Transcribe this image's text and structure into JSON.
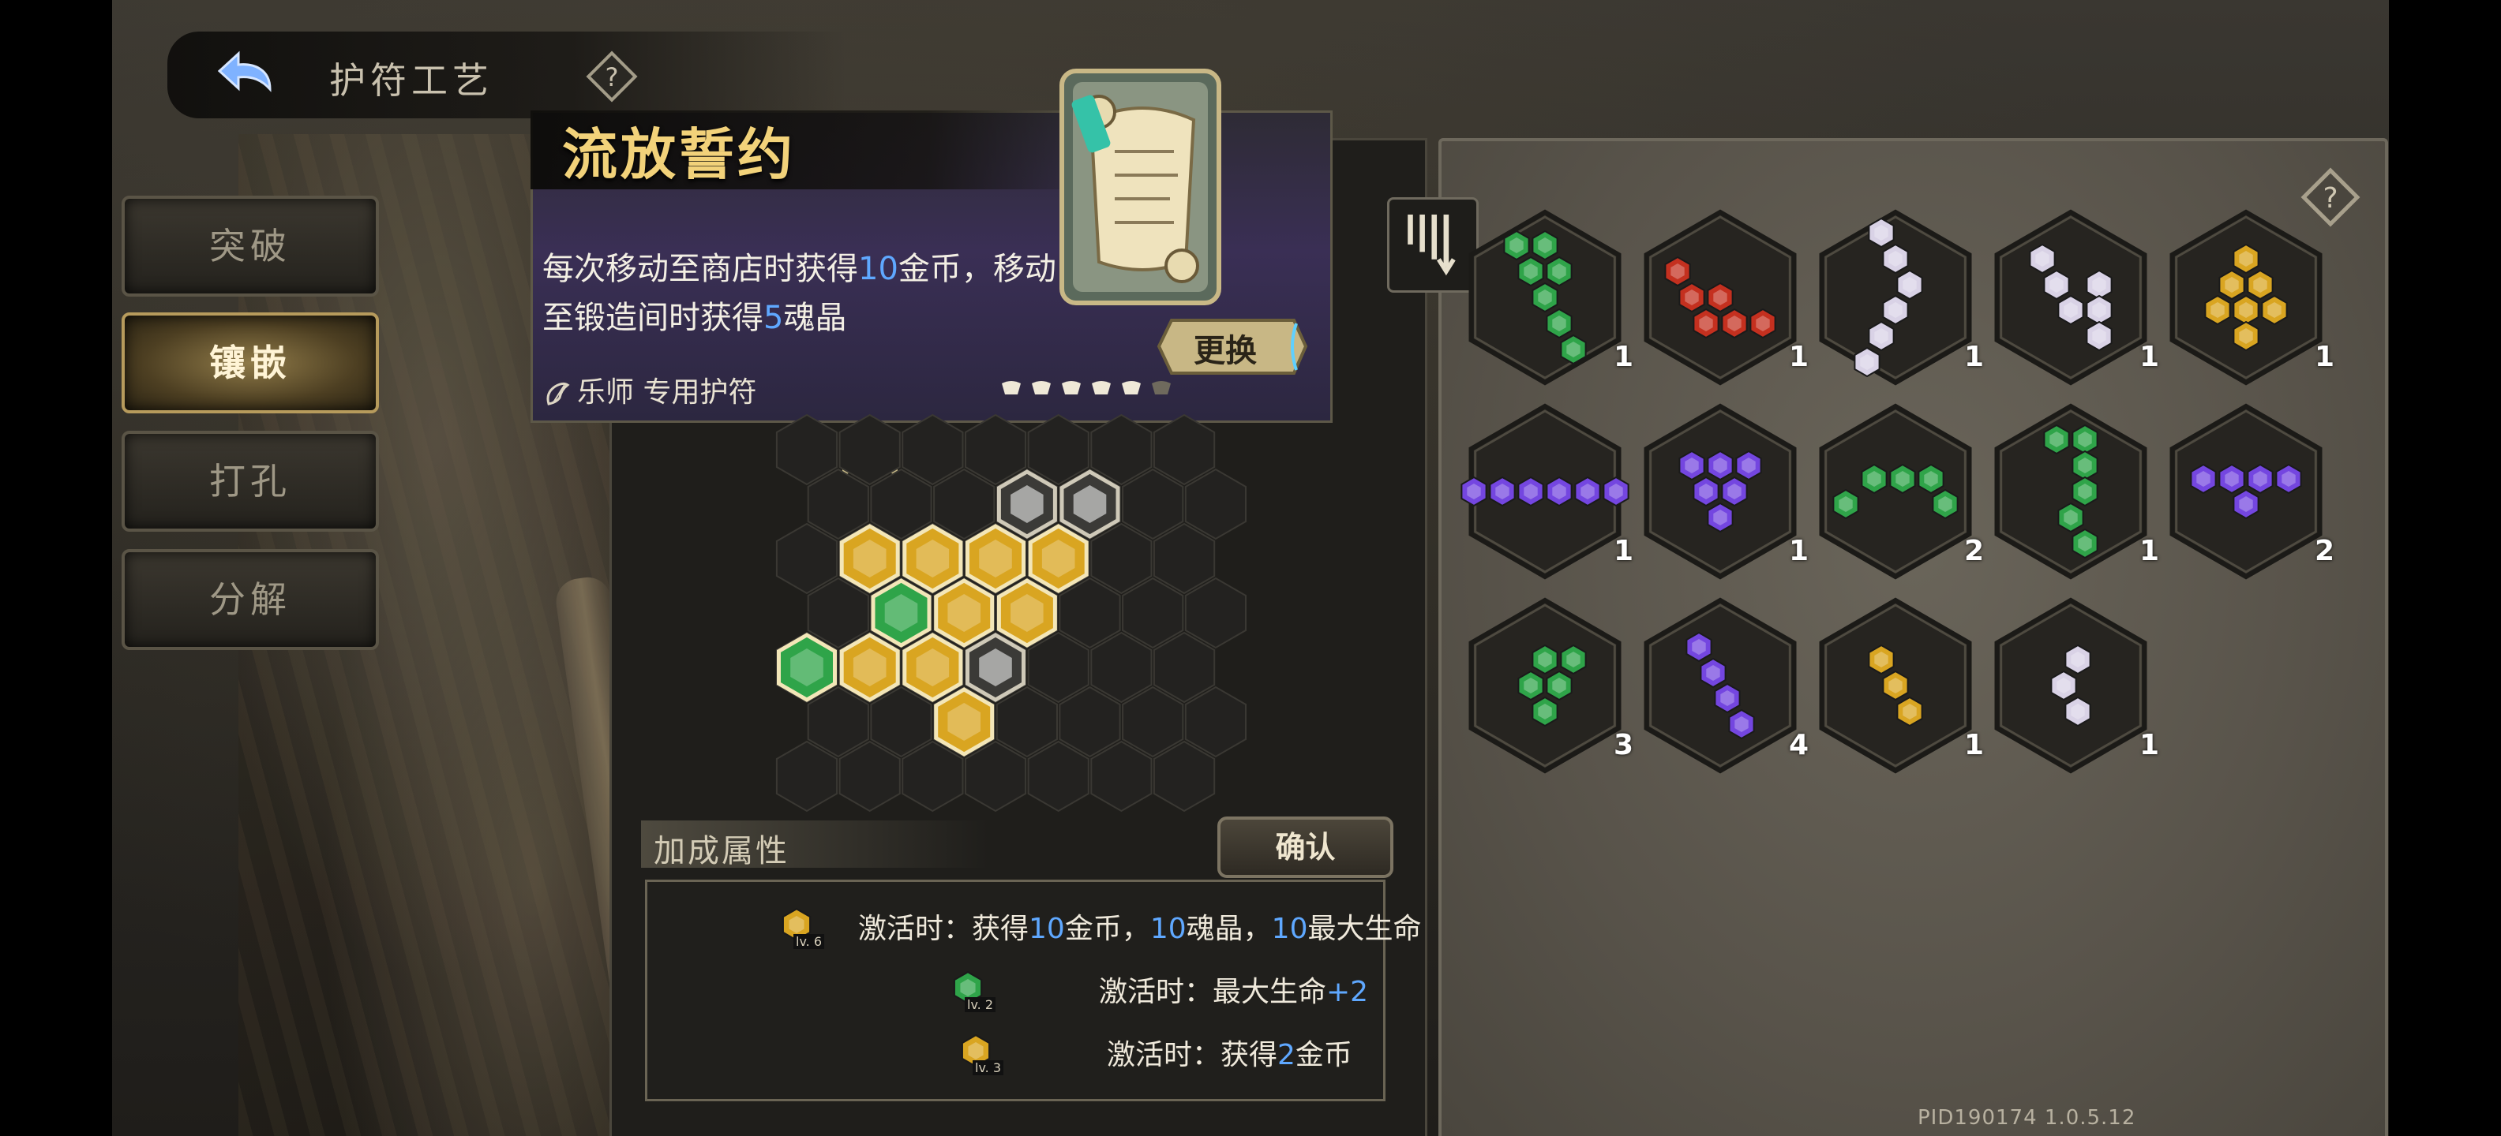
{
  "header": {
    "title": "护符工艺",
    "back_icon": "back-arrow-icon",
    "help_icon": "help-icon"
  },
  "tabs": [
    {
      "label": "突破",
      "active": false
    },
    {
      "label": "镶嵌",
      "active": true
    },
    {
      "label": "打孔",
      "active": false
    },
    {
      "label": "分解",
      "active": false
    }
  ],
  "card": {
    "title": "流放誓约",
    "desc_p1": "每次移动至商店时获得",
    "desc_n1": "10",
    "desc_p2": "金币，移动至锻造间时获得",
    "desc_n2": "5",
    "desc_p3": "魂晶",
    "type_label": "乐师 专用护符",
    "stars_filled": 5,
    "stars_total": 6,
    "swap_label": "更换"
  },
  "board": {
    "placed": [
      {
        "c": 3,
        "r": 1,
        "type": "white"
      },
      {
        "c": 4,
        "r": 1,
        "type": "white"
      },
      {
        "c": 1,
        "r": 2,
        "type": "gold"
      },
      {
        "c": 2,
        "r": 2,
        "type": "gold"
      },
      {
        "c": 3,
        "r": 2,
        "type": "gold"
      },
      {
        "c": 4,
        "r": 2,
        "type": "gold"
      },
      {
        "c": 1,
        "r": 3,
        "type": "green"
      },
      {
        "c": 2,
        "r": 3,
        "type": "gold"
      },
      {
        "c": 3,
        "r": 3,
        "type": "gold"
      },
      {
        "c": 0,
        "r": 4,
        "type": "green"
      },
      {
        "c": 1,
        "r": 4,
        "type": "gold"
      },
      {
        "c": 2,
        "r": 4,
        "type": "gold"
      },
      {
        "c": 3,
        "r": 4,
        "type": "white"
      },
      {
        "c": 2,
        "r": 5,
        "type": "gold"
      }
    ]
  },
  "bonus": {
    "heading": "加成属性",
    "confirm_label": "确认",
    "rows": [
      {
        "gem": "gold",
        "level": "lv. 6",
        "prefix": "激活时：获得",
        "parts": [
          {
            "t": "10",
            "hl": true
          },
          {
            "t": "金币，",
            "hl": false
          },
          {
            "t": "10",
            "hl": true
          },
          {
            "t": "魂晶，",
            "hl": false
          },
          {
            "t": "10",
            "hl": true
          },
          {
            "t": "最大生命",
            "hl": false
          }
        ]
      },
      {
        "gem": "green",
        "level": "lv. 2",
        "prefix": "激活时：最大生命",
        "parts": [
          {
            "t": "+2",
            "hl": true
          }
        ]
      },
      {
        "gem": "gold",
        "level": "lv. 3",
        "prefix": "激活时：获得",
        "parts": [
          {
            "t": "2",
            "hl": true
          },
          {
            "t": "金币",
            "hl": false
          }
        ]
      }
    ]
  },
  "inventory": [
    {
      "color": "green",
      "count": "1"
    },
    {
      "color": "red",
      "count": "1"
    },
    {
      "color": "white",
      "count": "1"
    },
    {
      "color": "white",
      "count": "1"
    },
    {
      "color": "gold",
      "count": "1"
    },
    {
      "color": "purple",
      "count": "1"
    },
    {
      "color": "purple",
      "count": "1"
    },
    {
      "color": "green",
      "count": "2"
    },
    {
      "color": "green",
      "count": "1"
    },
    {
      "color": "purple",
      "count": "2"
    },
    {
      "color": "green",
      "count": "3"
    },
    {
      "color": "purple",
      "count": "4"
    },
    {
      "color": "gold",
      "count": "1"
    },
    {
      "color": "white",
      "count": "1"
    }
  ],
  "colors": {
    "gold": "#d9a521",
    "green": "#2fa449",
    "red": "#c4301f",
    "purple": "#7446e0",
    "white": "#d9d2e6",
    "highlight": "#5fa8ff"
  },
  "version": "PID190174  1.0.5.12"
}
